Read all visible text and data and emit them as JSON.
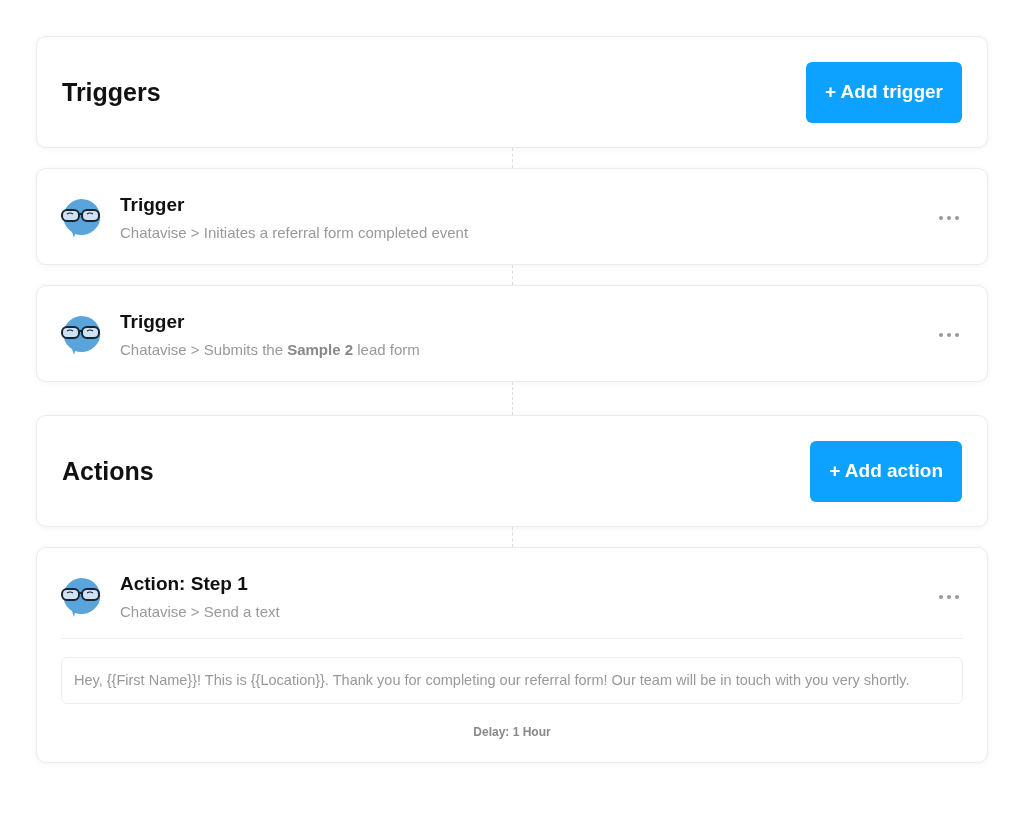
{
  "triggers": {
    "title": "Triggers",
    "button": "+ Add trigger",
    "items": [
      {
        "title": "Trigger",
        "subtitle": "Chatavise > Initiates a referral form completed event"
      },
      {
        "title": "Trigger",
        "subtitle": "Chatavise > Submits the **Sample 2** lead form"
      }
    ]
  },
  "actions": {
    "title": "Actions",
    "button": "+ Add action",
    "items": [
      {
        "title": "Action: Step 1",
        "subtitle": "Chatavise > Send a text",
        "message": "Hey, {{First Name}}! This is {{Location}}. Thank you for completing our referral form! Our team will be in touch with you very shortly.",
        "delay": "Delay: 1 Hour"
      }
    ]
  }
}
